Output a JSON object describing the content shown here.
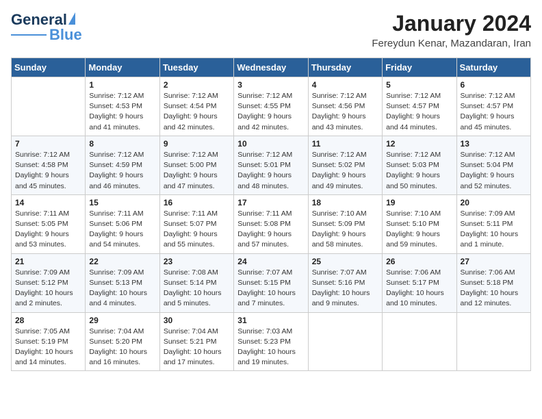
{
  "header": {
    "logo_general": "General",
    "logo_blue": "Blue",
    "month_title": "January 2024",
    "subtitle": "Fereydun Kenar, Mazandaran, Iran"
  },
  "days_of_week": [
    "Sunday",
    "Monday",
    "Tuesday",
    "Wednesday",
    "Thursday",
    "Friday",
    "Saturday"
  ],
  "weeks": [
    [
      {
        "day": "",
        "sunrise": "",
        "sunset": "",
        "daylight": ""
      },
      {
        "day": "1",
        "sunrise": "Sunrise: 7:12 AM",
        "sunset": "Sunset: 4:53 PM",
        "daylight": "Daylight: 9 hours and 41 minutes."
      },
      {
        "day": "2",
        "sunrise": "Sunrise: 7:12 AM",
        "sunset": "Sunset: 4:54 PM",
        "daylight": "Daylight: 9 hours and 42 minutes."
      },
      {
        "day": "3",
        "sunrise": "Sunrise: 7:12 AM",
        "sunset": "Sunset: 4:55 PM",
        "daylight": "Daylight: 9 hours and 42 minutes."
      },
      {
        "day": "4",
        "sunrise": "Sunrise: 7:12 AM",
        "sunset": "Sunset: 4:56 PM",
        "daylight": "Daylight: 9 hours and 43 minutes."
      },
      {
        "day": "5",
        "sunrise": "Sunrise: 7:12 AM",
        "sunset": "Sunset: 4:57 PM",
        "daylight": "Daylight: 9 hours and 44 minutes."
      },
      {
        "day": "6",
        "sunrise": "Sunrise: 7:12 AM",
        "sunset": "Sunset: 4:57 PM",
        "daylight": "Daylight: 9 hours and 45 minutes."
      }
    ],
    [
      {
        "day": "7",
        "sunrise": "Sunrise: 7:12 AM",
        "sunset": "Sunset: 4:58 PM",
        "daylight": "Daylight: 9 hours and 45 minutes."
      },
      {
        "day": "8",
        "sunrise": "Sunrise: 7:12 AM",
        "sunset": "Sunset: 4:59 PM",
        "daylight": "Daylight: 9 hours and 46 minutes."
      },
      {
        "day": "9",
        "sunrise": "Sunrise: 7:12 AM",
        "sunset": "Sunset: 5:00 PM",
        "daylight": "Daylight: 9 hours and 47 minutes."
      },
      {
        "day": "10",
        "sunrise": "Sunrise: 7:12 AM",
        "sunset": "Sunset: 5:01 PM",
        "daylight": "Daylight: 9 hours and 48 minutes."
      },
      {
        "day": "11",
        "sunrise": "Sunrise: 7:12 AM",
        "sunset": "Sunset: 5:02 PM",
        "daylight": "Daylight: 9 hours and 49 minutes."
      },
      {
        "day": "12",
        "sunrise": "Sunrise: 7:12 AM",
        "sunset": "Sunset: 5:03 PM",
        "daylight": "Daylight: 9 hours and 50 minutes."
      },
      {
        "day": "13",
        "sunrise": "Sunrise: 7:12 AM",
        "sunset": "Sunset: 5:04 PM",
        "daylight": "Daylight: 9 hours and 52 minutes."
      }
    ],
    [
      {
        "day": "14",
        "sunrise": "Sunrise: 7:11 AM",
        "sunset": "Sunset: 5:05 PM",
        "daylight": "Daylight: 9 hours and 53 minutes."
      },
      {
        "day": "15",
        "sunrise": "Sunrise: 7:11 AM",
        "sunset": "Sunset: 5:06 PM",
        "daylight": "Daylight: 9 hours and 54 minutes."
      },
      {
        "day": "16",
        "sunrise": "Sunrise: 7:11 AM",
        "sunset": "Sunset: 5:07 PM",
        "daylight": "Daylight: 9 hours and 55 minutes."
      },
      {
        "day": "17",
        "sunrise": "Sunrise: 7:11 AM",
        "sunset": "Sunset: 5:08 PM",
        "daylight": "Daylight: 9 hours and 57 minutes."
      },
      {
        "day": "18",
        "sunrise": "Sunrise: 7:10 AM",
        "sunset": "Sunset: 5:09 PM",
        "daylight": "Daylight: 9 hours and 58 minutes."
      },
      {
        "day": "19",
        "sunrise": "Sunrise: 7:10 AM",
        "sunset": "Sunset: 5:10 PM",
        "daylight": "Daylight: 9 hours and 59 minutes."
      },
      {
        "day": "20",
        "sunrise": "Sunrise: 7:09 AM",
        "sunset": "Sunset: 5:11 PM",
        "daylight": "Daylight: 10 hours and 1 minute."
      }
    ],
    [
      {
        "day": "21",
        "sunrise": "Sunrise: 7:09 AM",
        "sunset": "Sunset: 5:12 PM",
        "daylight": "Daylight: 10 hours and 2 minutes."
      },
      {
        "day": "22",
        "sunrise": "Sunrise: 7:09 AM",
        "sunset": "Sunset: 5:13 PM",
        "daylight": "Daylight: 10 hours and 4 minutes."
      },
      {
        "day": "23",
        "sunrise": "Sunrise: 7:08 AM",
        "sunset": "Sunset: 5:14 PM",
        "daylight": "Daylight: 10 hours and 5 minutes."
      },
      {
        "day": "24",
        "sunrise": "Sunrise: 7:07 AM",
        "sunset": "Sunset: 5:15 PM",
        "daylight": "Daylight: 10 hours and 7 minutes."
      },
      {
        "day": "25",
        "sunrise": "Sunrise: 7:07 AM",
        "sunset": "Sunset: 5:16 PM",
        "daylight": "Daylight: 10 hours and 9 minutes."
      },
      {
        "day": "26",
        "sunrise": "Sunrise: 7:06 AM",
        "sunset": "Sunset: 5:17 PM",
        "daylight": "Daylight: 10 hours and 10 minutes."
      },
      {
        "day": "27",
        "sunrise": "Sunrise: 7:06 AM",
        "sunset": "Sunset: 5:18 PM",
        "daylight": "Daylight: 10 hours and 12 minutes."
      }
    ],
    [
      {
        "day": "28",
        "sunrise": "Sunrise: 7:05 AM",
        "sunset": "Sunset: 5:19 PM",
        "daylight": "Daylight: 10 hours and 14 minutes."
      },
      {
        "day": "29",
        "sunrise": "Sunrise: 7:04 AM",
        "sunset": "Sunset: 5:20 PM",
        "daylight": "Daylight: 10 hours and 16 minutes."
      },
      {
        "day": "30",
        "sunrise": "Sunrise: 7:04 AM",
        "sunset": "Sunset: 5:21 PM",
        "daylight": "Daylight: 10 hours and 17 minutes."
      },
      {
        "day": "31",
        "sunrise": "Sunrise: 7:03 AM",
        "sunset": "Sunset: 5:23 PM",
        "daylight": "Daylight: 10 hours and 19 minutes."
      },
      {
        "day": "",
        "sunrise": "",
        "sunset": "",
        "daylight": ""
      },
      {
        "day": "",
        "sunrise": "",
        "sunset": "",
        "daylight": ""
      },
      {
        "day": "",
        "sunrise": "",
        "sunset": "",
        "daylight": ""
      }
    ]
  ]
}
